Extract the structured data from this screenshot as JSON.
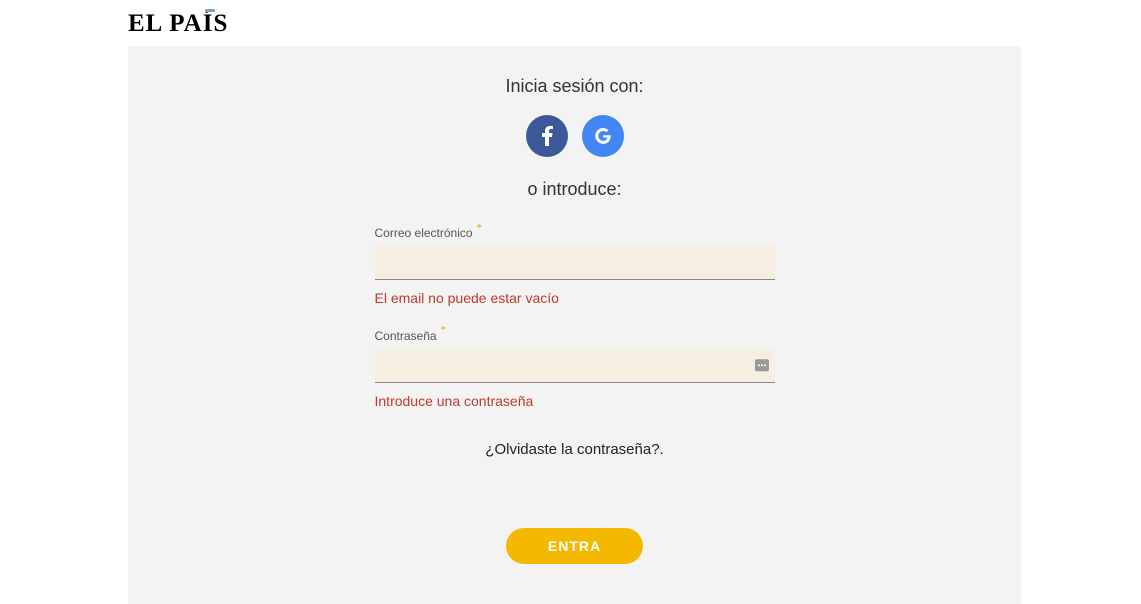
{
  "brand": {
    "name": "EL PAÍS"
  },
  "login": {
    "heading": "Inicia sesión con:",
    "subheading": "o introduce:",
    "email": {
      "label": "Correo electrónico",
      "value": "",
      "error": "El email no puede estar vacío"
    },
    "password": {
      "label": "Contraseña",
      "value": "",
      "error": "Introduce una contraseña"
    },
    "forgot": "¿Olvidaste la contraseña?.",
    "submit": "ENTRA",
    "social": {
      "facebook": "f",
      "google": "G"
    }
  }
}
